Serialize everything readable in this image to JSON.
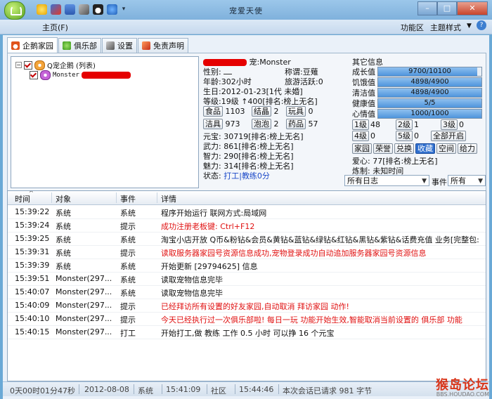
{
  "window": {
    "title": "宠爱天使"
  },
  "menubar": {
    "main_menu": "主页(F)",
    "function_area": "功能区",
    "theme": "主题样式"
  },
  "tabs": [
    {
      "label": "企鹅家园",
      "icon": "penguin-icon",
      "active": true
    },
    {
      "label": "俱乐部",
      "icon": "club-icon",
      "active": false
    },
    {
      "label": "设置",
      "icon": "tools-icon",
      "active": false
    },
    {
      "label": "免责声明",
      "icon": "disclaimer-icon",
      "active": false
    }
  ],
  "tree": {
    "root_label": "Q宠企鹅 (列表)",
    "child_label": "Monster"
  },
  "pet": {
    "name_label": "宠:Monster",
    "gender": "性别:",
    "title_label": "称谓:豆薙",
    "age": "年龄:302小时",
    "travel": "旅游活跃:0",
    "birthday": "生日:2012-01-23[1代 未婚]",
    "level": "等级:19级 ↑400[排名:榜上无名]",
    "items": [
      {
        "label": "食品",
        "value": "1103"
      },
      {
        "label": "结晶",
        "value": "2"
      },
      {
        "label": "玩具",
        "value": "0"
      },
      {
        "label": "洁具",
        "value": "973"
      },
      {
        "label": "泡泡",
        "value": "2"
      },
      {
        "label": "药品",
        "value": "57"
      }
    ],
    "yuanbao": "元宝: 30719[排名:榜上无名]",
    "force": "武力: 861[排名:榜上无名]",
    "intel": "智力: 290[排名:榜上无名]",
    "charm": "魅力: 314[排名:榜上无名]",
    "state_label": "状态:",
    "state_work": "打工",
    "state_sep": "|",
    "state_coach": "教练0分"
  },
  "stats": {
    "header": "其它信息",
    "bars": [
      {
        "label": "成长值",
        "text": "9700/10100",
        "pct": 0.96
      },
      {
        "label": "饥饿值",
        "text": "4898/4900",
        "pct": 0.9996
      },
      {
        "label": "清洁值",
        "text": "4898/4900",
        "pct": 0.9996
      },
      {
        "label": "健康值",
        "text": "5/5",
        "pct": 1.0
      },
      {
        "label": "心情值",
        "text": "1000/1000",
        "pct": 1.0
      }
    ],
    "levels_row1": [
      {
        "label": "1级",
        "value": "48"
      },
      {
        "label": "2级",
        "value": "1"
      },
      {
        "label": "3级",
        "value": "0"
      }
    ],
    "levels_row2": [
      {
        "label": "4级",
        "value": "0"
      },
      {
        "label": "5级",
        "value": "0"
      }
    ],
    "open_all": "全部开启",
    "actions": [
      "家园",
      "荣誉",
      "兑换",
      "收藏",
      "空间",
      "给力"
    ],
    "love": "爱心: 77[排名:榜上无名]",
    "refine": "炼制: 未知时间"
  },
  "filters": {
    "log_select": "所有日志",
    "event_label": "事件",
    "event_select": "所有"
  },
  "grid": {
    "headers": [
      "时间",
      "对象",
      "事件",
      "详情"
    ],
    "rows": [
      {
        "time": "15:39:22",
        "obj": "系统",
        "event": "系统",
        "detail": "程序开始运行 联网方式:局域网",
        "red": false
      },
      {
        "time": "15:39:24",
        "obj": "系统",
        "event": "提示",
        "detail": "成功注册老板键: Ctrl+F12",
        "red": true
      },
      {
        "time": "15:39:25",
        "obj": "系统",
        "event": "系统",
        "detail": "淘宝小店开放 Q币&粉钻&会员&黄钻&蓝钻&绿钻&红钻&黑钻&紫钻&话费充值 业务[完整包:",
        "red": false
      },
      {
        "time": "15:39:31",
        "obj": "系统",
        "event": "提示",
        "detail": "读取服务器家园号资源信息成功,宠物登录成功自动追加服务器家园号资源信息",
        "red": true
      },
      {
        "time": "15:39:39",
        "obj": "系统",
        "event": "系统",
        "detail": "开始更新 [29794625] 信息",
        "red": false
      },
      {
        "time": "15:39:51",
        "obj": "Monster(297...",
        "event": "系统",
        "detail": "读取宠物信息完毕",
        "red": false
      },
      {
        "time": "15:40:07",
        "obj": "Monster(297...",
        "event": "系统",
        "detail": "读取宠物信息完毕",
        "red": false
      },
      {
        "time": "15:40:09",
        "obj": "Monster(297...",
        "event": "提示",
        "detail": "已经拜访所有设置的好友家园,自动取消 拜访家园 动作!",
        "red": true
      },
      {
        "time": "15:40:10",
        "obj": "Monster(297...",
        "event": "提示",
        "detail": "今天已经执行过一次俱乐部啦! 每日一玩 功能开始生效,智能取消当前设置的 俱乐部 功能",
        "red": true
      },
      {
        "time": "15:40:15",
        "obj": "Monster(297...",
        "event": "打工",
        "detail": "开始打工,做 教练 工作 0.5 小时 可以挣 16 个元宝",
        "red": false
      }
    ]
  },
  "status": {
    "uptime": "0天00时01分47秒",
    "date": "2012-08-08",
    "sys_label": "系统",
    "sys_time": "15:41:09",
    "community_label": "社区",
    "community_time": "15:44:46",
    "session": "本次会话已请求 981 字节"
  },
  "watermark": {
    "brand": "猴岛论坛",
    "url": "BBS.HOUDAO.COM"
  }
}
